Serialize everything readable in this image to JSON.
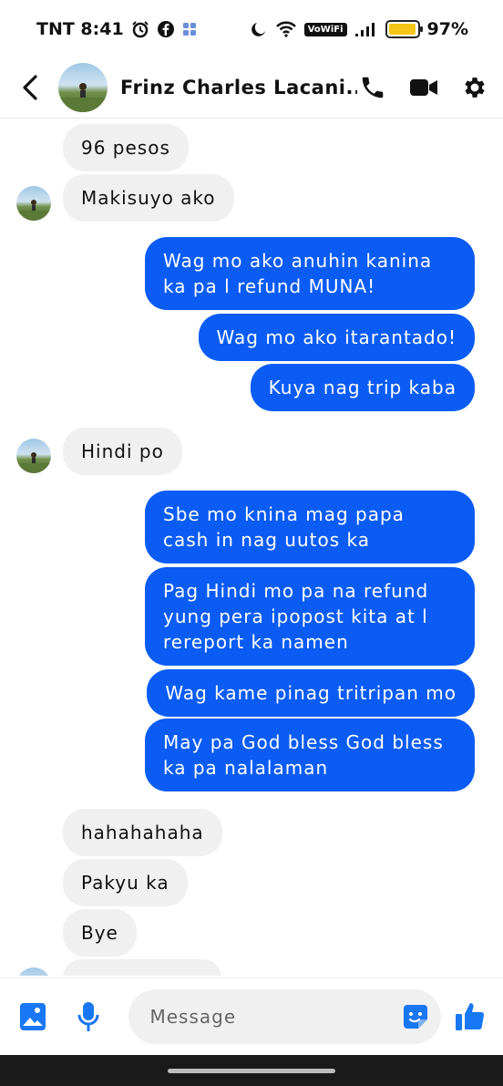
{
  "status_bar": {
    "carrier_time": "TNT 8:41",
    "vowifi": "VoWiFi",
    "battery_percent": "97%",
    "battery_level": 0.97
  },
  "header": {
    "contact_name": "Frinz Charles Lacani..."
  },
  "messages": [
    {
      "from": "them",
      "text": "96 pesos"
    },
    {
      "from": "them",
      "text": "Makisuyo ako"
    },
    {
      "from": "me",
      "text": "Wag mo ako anuhin  kanina ka pa l refund MUNA!"
    },
    {
      "from": "me",
      "text": "Wag mo ako itarantado!"
    },
    {
      "from": "me",
      "text": "Kuya nag trip kaba"
    },
    {
      "from": "them",
      "text": "Hindi po"
    },
    {
      "from": "me",
      "text": "Sbe mo knina mag papa cash in nag uutos ka"
    },
    {
      "from": "me",
      "text": "Pag Hindi mo pa na refund yung pera ipopost kita at l rereport ka namen"
    },
    {
      "from": "me",
      "text": "Wag kame pinag tritripan mo"
    },
    {
      "from": "me",
      "text": "May pa God bless God bless ka pa nalalaman"
    },
    {
      "from": "them",
      "text": "hahahahaha"
    },
    {
      "from": "them",
      "text": "Pakyu ka"
    },
    {
      "from": "them",
      "text": "Bye"
    }
  ],
  "composer": {
    "placeholder": "Message"
  },
  "colors": {
    "outgoing_bubble": "#0a5cf5",
    "incoming_bubble": "#f0f0f0",
    "accent": "#1877f2"
  }
}
